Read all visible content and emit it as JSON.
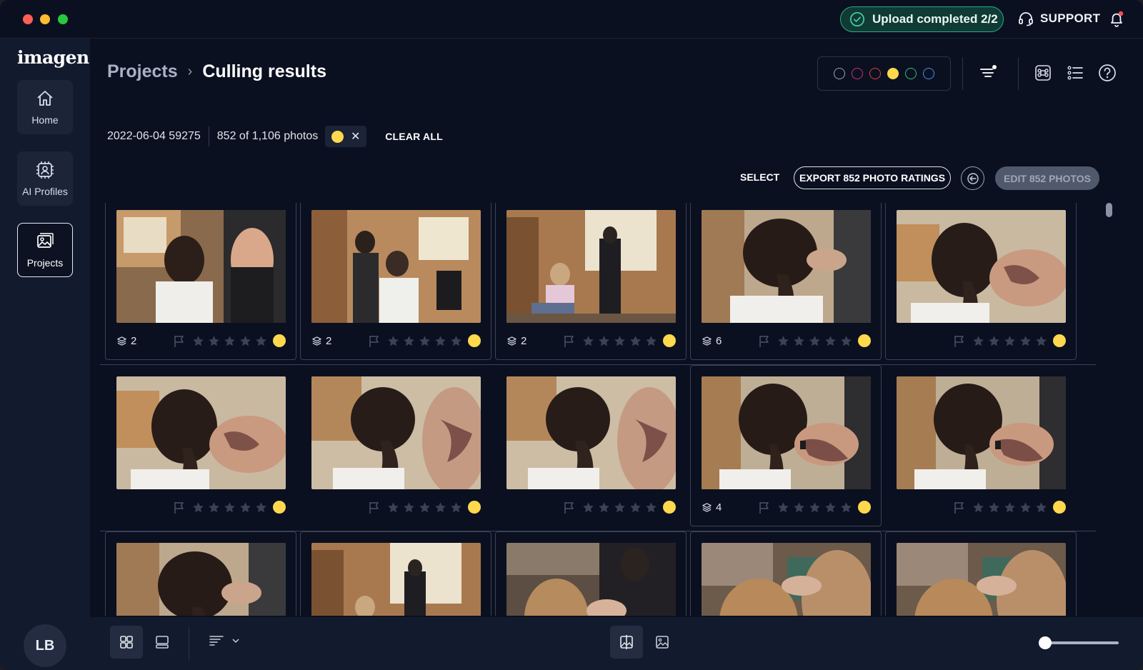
{
  "titlebar": {
    "upload_status": "Upload completed 2/2",
    "support_label": "SUPPORT"
  },
  "sidebar": {
    "logo": "imagen",
    "items": [
      {
        "label": "Home",
        "icon": "home-icon"
      },
      {
        "label": "AI Profiles",
        "icon": "ai-profile-icon"
      },
      {
        "label": "Projects",
        "icon": "gallery-icon",
        "active": true
      }
    ],
    "avatar_initials": "LB"
  },
  "header": {
    "breadcrumb_parent": "Projects",
    "breadcrumb_separator": "›",
    "breadcrumb_current": "Culling results",
    "color_labels": [
      {
        "color": "#9aa3b5",
        "selected": false
      },
      {
        "color": "#c0386b",
        "selected": false
      },
      {
        "color": "#d8453f",
        "selected": false
      },
      {
        "color": "#ffd84d",
        "selected": true
      },
      {
        "color": "#2fbf7a",
        "selected": false
      },
      {
        "color": "#4a8df0",
        "selected": false
      }
    ]
  },
  "filters": {
    "project_name": "2022-06-04 59275",
    "photo_count": "852 of 1,106 photos",
    "active_chip_color": "#ffd84d",
    "chip_remove": "✕",
    "clear_all": "CLEAR ALL"
  },
  "actions": {
    "select": "SELECT",
    "export": "EXPORT 852 PHOTO RATINGS",
    "edit": "EDIT 852 PHOTOS"
  },
  "grid": {
    "rows": [
      [
        {
          "stack": "2",
          "label": "yellow",
          "scene": "stylist-standing"
        },
        {
          "stack": "2",
          "label": "yellow",
          "scene": "room-two"
        },
        {
          "stack": "2",
          "label": "yellow",
          "scene": "room-wide"
        },
        {
          "stack": "6",
          "label": "yellow",
          "scene": "braid-back"
        },
        {
          "stack": "",
          "label": "yellow",
          "scene": "braid-tattoo"
        }
      ],
      [
        {
          "stack": "",
          "label": "yellow",
          "scene": "braid-tattoo"
        },
        {
          "stack": "",
          "label": "yellow",
          "scene": "braid-side"
        },
        {
          "stack": "",
          "label": "yellow",
          "scene": "braid-side"
        },
        {
          "stack": "4",
          "label": "yellow",
          "scene": "braid-hands"
        },
        {
          "stack": "",
          "label": "yellow",
          "scene": "braid-hands"
        }
      ],
      [
        {
          "stack": "",
          "label": "yellow",
          "scene": "braid-back"
        },
        {
          "stack": "",
          "label": "yellow",
          "scene": "room-wide"
        },
        {
          "stack": "",
          "label": "yellow",
          "scene": "blonde-stylist"
        },
        {
          "stack": "",
          "label": "yellow",
          "scene": "blonde-close"
        },
        {
          "stack": "",
          "label": "yellow",
          "scene": "blonde-close"
        }
      ]
    ],
    "stars_per_photo": 5
  },
  "bottombar": {
    "zoom_level": 0.05
  }
}
